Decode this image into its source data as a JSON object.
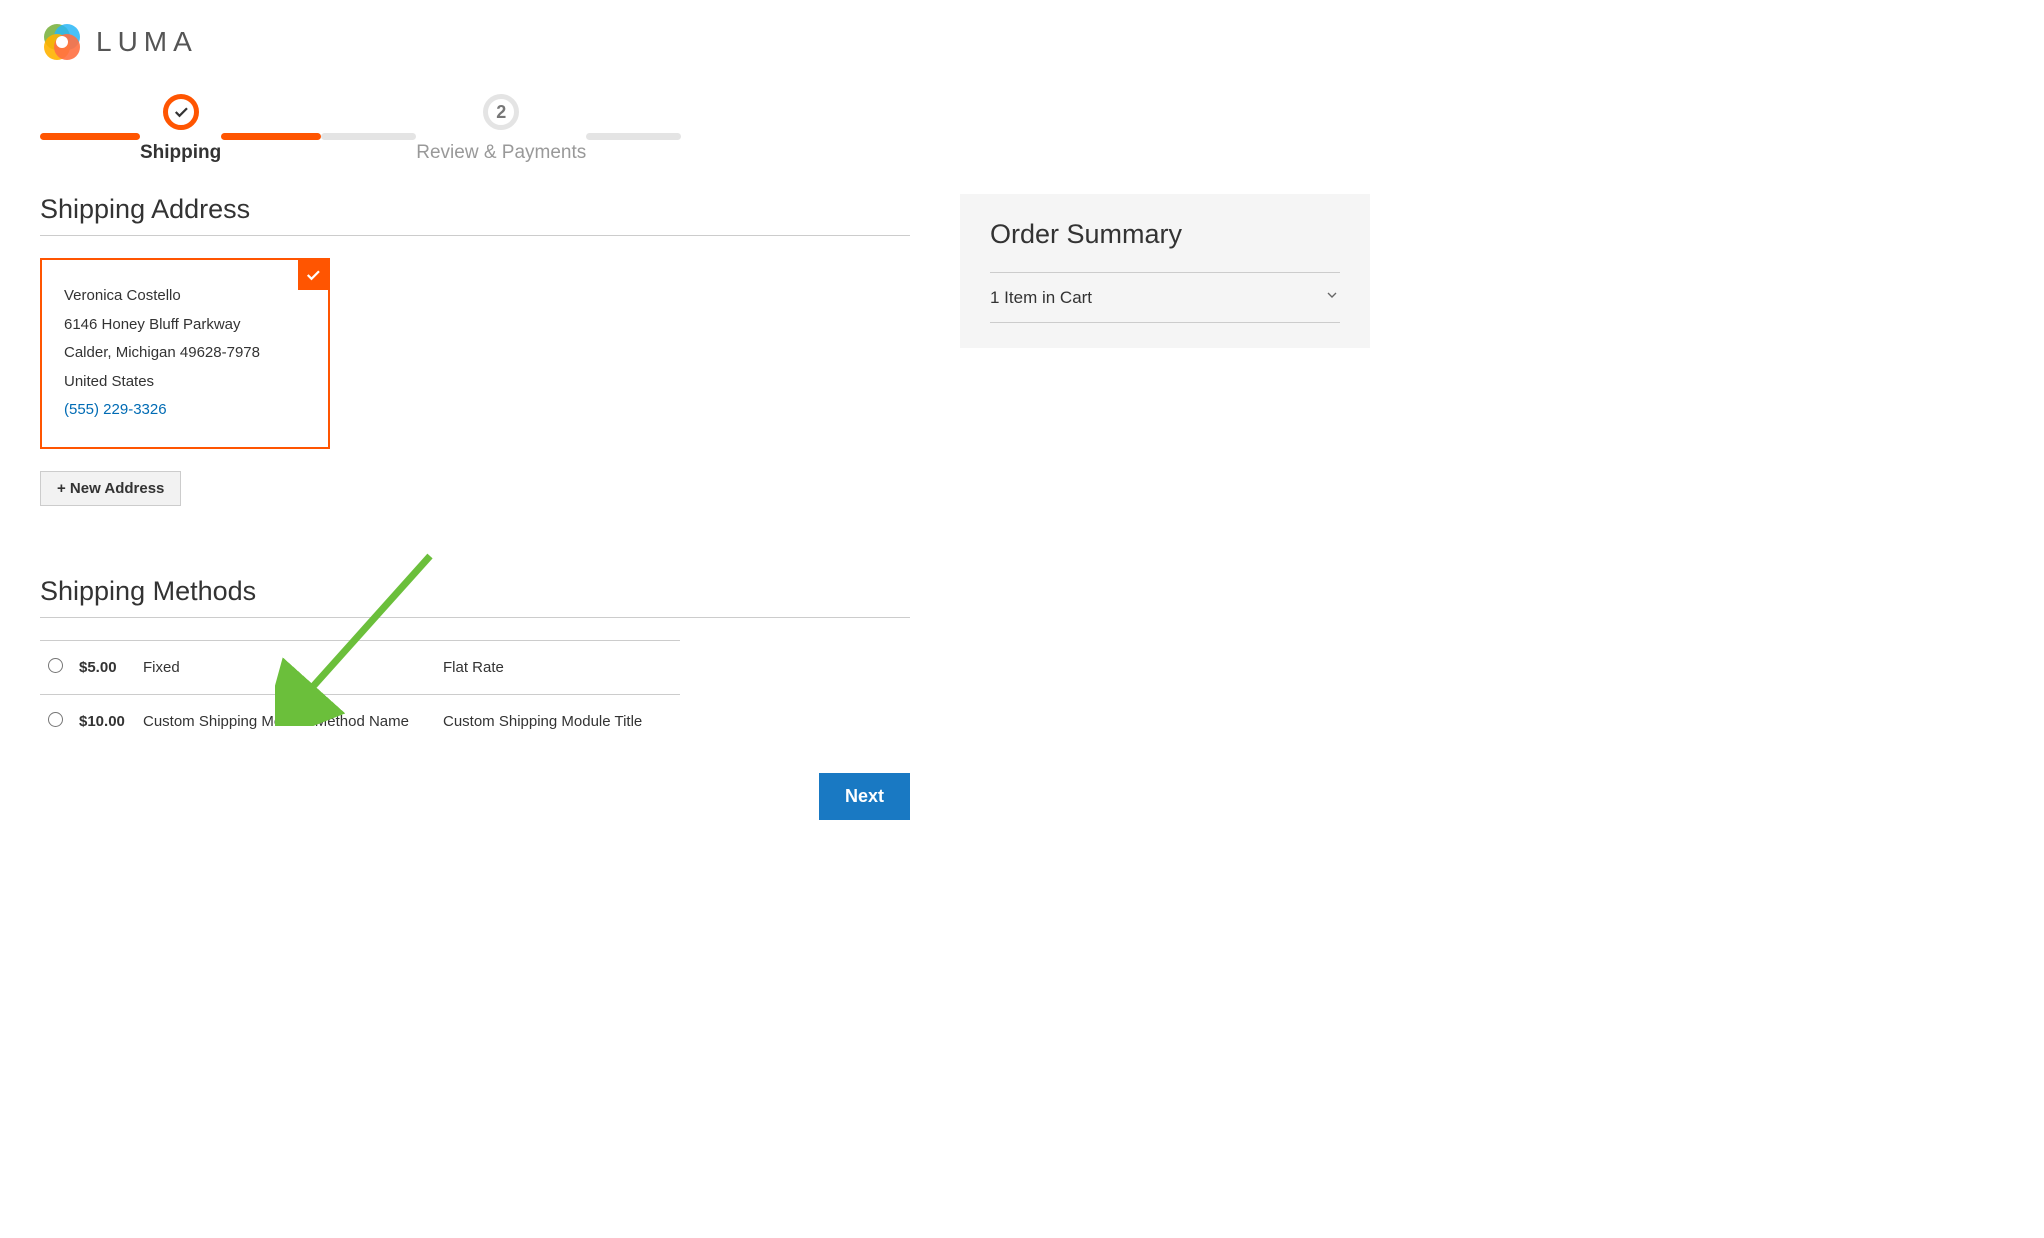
{
  "logo": {
    "text": "LUMA"
  },
  "progress": {
    "step1": {
      "label": "Shipping"
    },
    "step2": {
      "number": "2",
      "label": "Review & Payments"
    }
  },
  "shipping_address_heading": "Shipping Address",
  "address": {
    "name": "Veronica Costello",
    "street": "6146 Honey Bluff Parkway",
    "city_region": "Calder, Michigan 49628-7978",
    "country": "United States",
    "phone": "(555) 229-3326"
  },
  "new_address_button": "+ New Address",
  "shipping_methods_heading": "Shipping Methods",
  "methods": [
    {
      "price": "$5.00",
      "name": "Fixed",
      "title": "Flat Rate"
    },
    {
      "price": "$10.00",
      "name": "Custom Shipping Module Method Name",
      "title": "Custom Shipping Module Title"
    }
  ],
  "next_button": "Next",
  "order_summary": {
    "heading": "Order Summary",
    "items_label": "1 Item in Cart"
  }
}
